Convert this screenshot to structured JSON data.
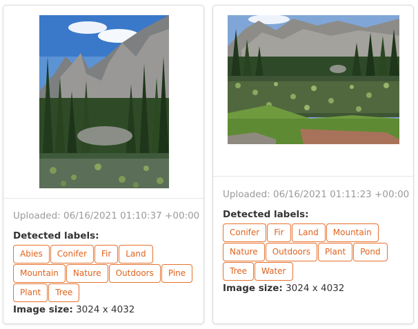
{
  "cards": [
    {
      "uploaded": "Uploaded: 06/16/2021 01:10:37 +00:00",
      "labels_title": "Detected labels:",
      "labels": [
        "Abies",
        "Conifer",
        "Fir",
        "Land",
        "Mountain",
        "Nature",
        "Outdoors",
        "Pine",
        "Plant",
        "Tree"
      ],
      "size_label": "Image size:",
      "size_value": "3024 x 4032"
    },
    {
      "uploaded": "Uploaded: 06/16/2021 01:11:23 +00:00",
      "labels_title": "Detected labels:",
      "labels": [
        "Conifer",
        "Fir",
        "Land",
        "Mountain",
        "Nature",
        "Outdoors",
        "Plant",
        "Pond",
        "Tree",
        "Water"
      ],
      "size_label": "Image size:",
      "size_value": "3024 x 4032"
    }
  ],
  "colors": {
    "tag_border": "#e6702c",
    "tag_text": "#e0621c",
    "muted_text": "#9a9a9a",
    "card_border": "#d9d9d9"
  }
}
